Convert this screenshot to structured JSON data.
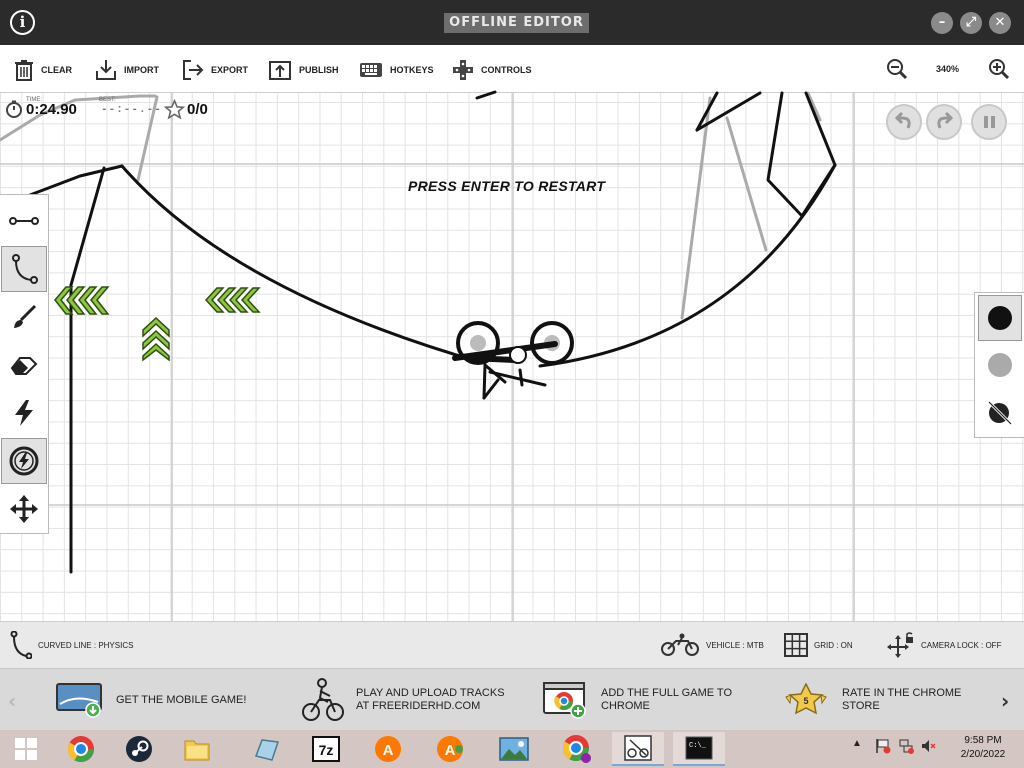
{
  "window": {
    "title": "OFFLINE EDITOR",
    "info_icon": "info-icon",
    "controls": [
      "minimize-icon",
      "maximize-icon",
      "close-icon"
    ]
  },
  "toolbar": {
    "items": [
      {
        "label": "CLEAR",
        "icon": "trash-icon"
      },
      {
        "label": "IMPORT",
        "icon": "download-icon"
      },
      {
        "label": "EXPORT",
        "icon": "export-icon"
      },
      {
        "label": "PUBLISH",
        "icon": "upload-icon"
      },
      {
        "label": "HOTKEYS",
        "icon": "keyboard-icon"
      },
      {
        "label": "CONTROLS",
        "icon": "gamepad-icon"
      }
    ],
    "zoom": "340%"
  },
  "hud": {
    "time_label": "TIME:",
    "time_value": "0:24.90",
    "best_label": "BEST:",
    "best_value": "--:--.--",
    "stars_value": "0/0",
    "message": "PRESS ENTER TO RESTART"
  },
  "tools": [
    {
      "name": "straight-line",
      "icon": "straight-line-icon",
      "active": false
    },
    {
      "name": "curved-line",
      "icon": "curve-icon",
      "active": true
    },
    {
      "name": "brush",
      "icon": "brush-icon",
      "active": false
    },
    {
      "name": "eraser",
      "icon": "eraser-icon",
      "active": false
    },
    {
      "name": "powerups",
      "icon": "lightning-icon",
      "active": false
    },
    {
      "name": "powerup-circle",
      "icon": "lightning-circle-icon",
      "active": true
    },
    {
      "name": "camera",
      "icon": "move-icon",
      "active": false
    }
  ],
  "line_colors": [
    {
      "name": "physics",
      "color": "#111111",
      "active": true
    },
    {
      "name": "scenery",
      "color": "#aaaaaa",
      "active": false
    },
    {
      "name": "toggle",
      "icon": "toggle-scenery-icon",
      "active": false
    }
  ],
  "status": {
    "tool": "CURVED LINE : PHYSICS",
    "vehicle": "VEHICLE : MTB",
    "grid": "GRID : ON",
    "camera_lock": "CAMERA LOCK : OFF"
  },
  "promos": [
    {
      "line1": "GET THE MOBILE GAME!",
      "line2": ""
    },
    {
      "line1": "PLAY AND UPLOAD TRACKS",
      "line2": "AT FREERIDERHD.COM"
    },
    {
      "line1": "ADD THE FULL GAME TO",
      "line2": "CHROME"
    },
    {
      "line1": "RATE IN THE CHROME",
      "line2": "STORE"
    }
  ],
  "taskbar": {
    "time": "9:58 PM",
    "date": "2/20/2022",
    "apps": [
      "windows-icon",
      "chrome-icon",
      "steam-icon",
      "folder-icon",
      "notebook-icon",
      "7zip-icon",
      "avast-icon",
      "avast-icon",
      "photos-icon",
      "chrome-profile-icon",
      "freerider-icon",
      "terminal-icon"
    ]
  }
}
